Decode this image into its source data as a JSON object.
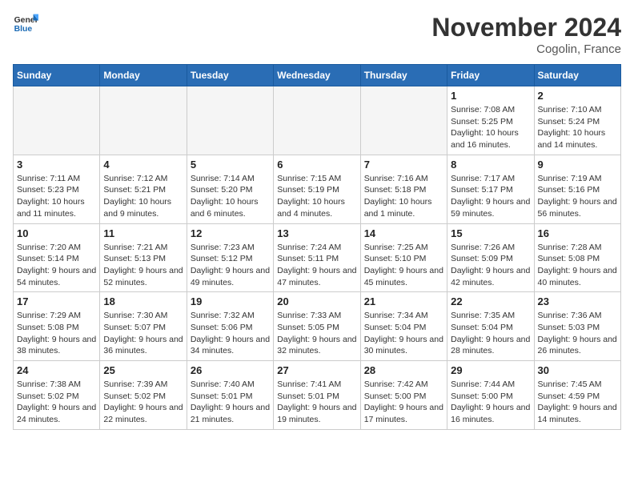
{
  "logo": {
    "text_general": "General",
    "text_blue": "Blue"
  },
  "title": "November 2024",
  "location": "Cogolin, France",
  "days_of_week": [
    "Sunday",
    "Monday",
    "Tuesday",
    "Wednesday",
    "Thursday",
    "Friday",
    "Saturday"
  ],
  "weeks": [
    [
      {
        "day": "",
        "info": ""
      },
      {
        "day": "",
        "info": ""
      },
      {
        "day": "",
        "info": ""
      },
      {
        "day": "",
        "info": ""
      },
      {
        "day": "",
        "info": ""
      },
      {
        "day": "1",
        "info": "Sunrise: 7:08 AM\nSunset: 5:25 PM\nDaylight: 10 hours and 16 minutes."
      },
      {
        "day": "2",
        "info": "Sunrise: 7:10 AM\nSunset: 5:24 PM\nDaylight: 10 hours and 14 minutes."
      }
    ],
    [
      {
        "day": "3",
        "info": "Sunrise: 7:11 AM\nSunset: 5:23 PM\nDaylight: 10 hours and 11 minutes."
      },
      {
        "day": "4",
        "info": "Sunrise: 7:12 AM\nSunset: 5:21 PM\nDaylight: 10 hours and 9 minutes."
      },
      {
        "day": "5",
        "info": "Sunrise: 7:14 AM\nSunset: 5:20 PM\nDaylight: 10 hours and 6 minutes."
      },
      {
        "day": "6",
        "info": "Sunrise: 7:15 AM\nSunset: 5:19 PM\nDaylight: 10 hours and 4 minutes."
      },
      {
        "day": "7",
        "info": "Sunrise: 7:16 AM\nSunset: 5:18 PM\nDaylight: 10 hours and 1 minute."
      },
      {
        "day": "8",
        "info": "Sunrise: 7:17 AM\nSunset: 5:17 PM\nDaylight: 9 hours and 59 minutes."
      },
      {
        "day": "9",
        "info": "Sunrise: 7:19 AM\nSunset: 5:16 PM\nDaylight: 9 hours and 56 minutes."
      }
    ],
    [
      {
        "day": "10",
        "info": "Sunrise: 7:20 AM\nSunset: 5:14 PM\nDaylight: 9 hours and 54 minutes."
      },
      {
        "day": "11",
        "info": "Sunrise: 7:21 AM\nSunset: 5:13 PM\nDaylight: 9 hours and 52 minutes."
      },
      {
        "day": "12",
        "info": "Sunrise: 7:23 AM\nSunset: 5:12 PM\nDaylight: 9 hours and 49 minutes."
      },
      {
        "day": "13",
        "info": "Sunrise: 7:24 AM\nSunset: 5:11 PM\nDaylight: 9 hours and 47 minutes."
      },
      {
        "day": "14",
        "info": "Sunrise: 7:25 AM\nSunset: 5:10 PM\nDaylight: 9 hours and 45 minutes."
      },
      {
        "day": "15",
        "info": "Sunrise: 7:26 AM\nSunset: 5:09 PM\nDaylight: 9 hours and 42 minutes."
      },
      {
        "day": "16",
        "info": "Sunrise: 7:28 AM\nSunset: 5:08 PM\nDaylight: 9 hours and 40 minutes."
      }
    ],
    [
      {
        "day": "17",
        "info": "Sunrise: 7:29 AM\nSunset: 5:08 PM\nDaylight: 9 hours and 38 minutes."
      },
      {
        "day": "18",
        "info": "Sunrise: 7:30 AM\nSunset: 5:07 PM\nDaylight: 9 hours and 36 minutes."
      },
      {
        "day": "19",
        "info": "Sunrise: 7:32 AM\nSunset: 5:06 PM\nDaylight: 9 hours and 34 minutes."
      },
      {
        "day": "20",
        "info": "Sunrise: 7:33 AM\nSunset: 5:05 PM\nDaylight: 9 hours and 32 minutes."
      },
      {
        "day": "21",
        "info": "Sunrise: 7:34 AM\nSunset: 5:04 PM\nDaylight: 9 hours and 30 minutes."
      },
      {
        "day": "22",
        "info": "Sunrise: 7:35 AM\nSunset: 5:04 PM\nDaylight: 9 hours and 28 minutes."
      },
      {
        "day": "23",
        "info": "Sunrise: 7:36 AM\nSunset: 5:03 PM\nDaylight: 9 hours and 26 minutes."
      }
    ],
    [
      {
        "day": "24",
        "info": "Sunrise: 7:38 AM\nSunset: 5:02 PM\nDaylight: 9 hours and 24 minutes."
      },
      {
        "day": "25",
        "info": "Sunrise: 7:39 AM\nSunset: 5:02 PM\nDaylight: 9 hours and 22 minutes."
      },
      {
        "day": "26",
        "info": "Sunrise: 7:40 AM\nSunset: 5:01 PM\nDaylight: 9 hours and 21 minutes."
      },
      {
        "day": "27",
        "info": "Sunrise: 7:41 AM\nSunset: 5:01 PM\nDaylight: 9 hours and 19 minutes."
      },
      {
        "day": "28",
        "info": "Sunrise: 7:42 AM\nSunset: 5:00 PM\nDaylight: 9 hours and 17 minutes."
      },
      {
        "day": "29",
        "info": "Sunrise: 7:44 AM\nSunset: 5:00 PM\nDaylight: 9 hours and 16 minutes."
      },
      {
        "day": "30",
        "info": "Sunrise: 7:45 AM\nSunset: 4:59 PM\nDaylight: 9 hours and 14 minutes."
      }
    ]
  ]
}
